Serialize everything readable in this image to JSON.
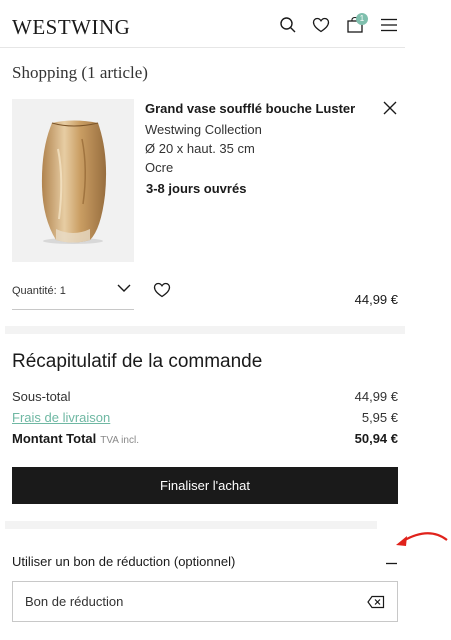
{
  "header": {
    "logo": "WESTWING",
    "cart_count": "1",
    "icons": [
      "search-icon",
      "heart-icon",
      "shopping-bag-icon",
      "menu-icon"
    ]
  },
  "cart": {
    "title": "Shopping (1 article)",
    "item": {
      "name": "Grand vase soufflé bouche Luster",
      "brand": "Westwing Collection",
      "dimensions": "Ø 20 x haut. 35 cm",
      "color": "Ocre",
      "delivery": "3-8 jours ouvrés",
      "quantity_label": "Quantité: 1",
      "price": "44,99 €"
    }
  },
  "summary": {
    "title": "Récapitulatif de la commande",
    "subtotal_label": "Sous-total",
    "subtotal_value": "44,99 €",
    "shipping_label": "Frais de livraison",
    "shipping_value": "5,95 €",
    "total_label": "Montant Total",
    "total_tax_note": "TVA incl.",
    "total_value": "50,94 €",
    "checkout_label": "Finaliser l'achat"
  },
  "voucher": {
    "label": "Utiliser un bon de réduction (optionnel)",
    "placeholder": "Bon de réduction"
  },
  "colors": {
    "accent": "#7fbfad",
    "link": "#6fb8a3",
    "button": "#1a1a1a",
    "annotation_arrow": "#e0221b"
  }
}
